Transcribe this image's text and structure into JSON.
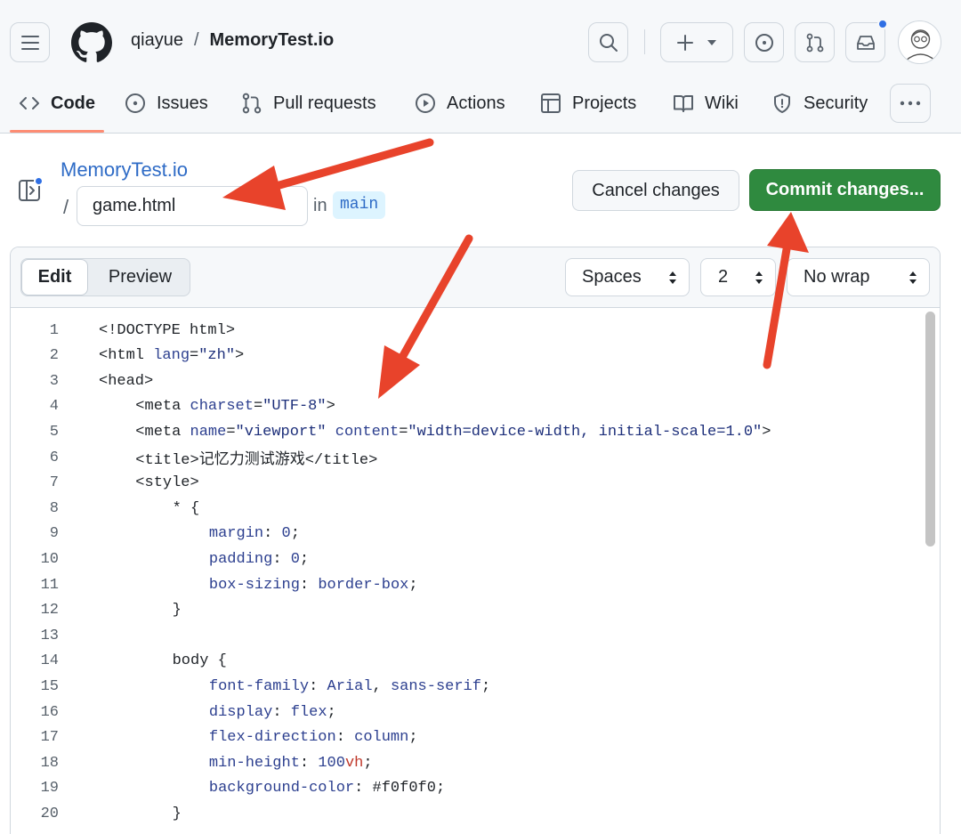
{
  "header": {
    "owner": "qiayue",
    "separator": "/",
    "repo": "MemoryTest.io"
  },
  "nav": {
    "tabs": [
      {
        "label": "Code",
        "icon": "code-icon",
        "active": true
      },
      {
        "label": "Issues",
        "icon": "issue-opened-icon"
      },
      {
        "label": "Pull requests",
        "icon": "git-pull-request-icon"
      },
      {
        "label": "Actions",
        "icon": "play-icon"
      },
      {
        "label": "Projects",
        "icon": "table-icon"
      },
      {
        "label": "Wiki",
        "icon": "book-icon"
      },
      {
        "label": "Security",
        "icon": "shield-icon"
      }
    ]
  },
  "file": {
    "repo_link": "MemoryTest.io",
    "path_sep": "/",
    "filename": "game.html",
    "in_label": "in",
    "branch": "main"
  },
  "actions": {
    "cancel": "Cancel changes",
    "commit": "Commit changes..."
  },
  "editor": {
    "mode_edit": "Edit",
    "mode_preview": "Preview",
    "indent_mode": "Spaces",
    "indent_size": "2",
    "wrap_mode": "No wrap"
  },
  "code_lines": [
    {
      "n": "1",
      "indent": 0,
      "parts": [
        [
          "",
          "<!DOCTYPE html>"
        ]
      ]
    },
    {
      "n": "2",
      "indent": 0,
      "parts": [
        [
          "",
          "<html "
        ],
        [
          "t-attr",
          "lang"
        ],
        [
          "",
          "="
        ],
        [
          "t-str",
          "\"zh\""
        ],
        [
          "",
          ">"
        ]
      ]
    },
    {
      "n": "3",
      "indent": 0,
      "parts": [
        [
          "",
          "<head>"
        ]
      ]
    },
    {
      "n": "4",
      "indent": 1,
      "parts": [
        [
          "",
          "<meta "
        ],
        [
          "t-attr",
          "charset"
        ],
        [
          "",
          "="
        ],
        [
          "t-str",
          "\"UTF-8\""
        ],
        [
          "",
          ">"
        ]
      ]
    },
    {
      "n": "5",
      "indent": 1,
      "parts": [
        [
          "",
          "<meta "
        ],
        [
          "t-attr",
          "name"
        ],
        [
          "",
          "="
        ],
        [
          "t-str",
          "\"viewport\""
        ],
        [
          "",
          " "
        ],
        [
          "t-attr",
          "content"
        ],
        [
          "",
          "="
        ],
        [
          "t-str",
          "\"width=device-width, initial-scale=1.0\""
        ],
        [
          "",
          ">"
        ]
      ]
    },
    {
      "n": "6",
      "indent": 1,
      "parts": [
        [
          "",
          "<title>记忆力测试游戏</title>"
        ]
      ]
    },
    {
      "n": "7",
      "indent": 1,
      "parts": [
        [
          "",
          "<style>"
        ]
      ]
    },
    {
      "n": "8",
      "indent": 2,
      "parts": [
        [
          "",
          "* {"
        ]
      ]
    },
    {
      "n": "9",
      "indent": 3,
      "parts": [
        [
          "t-prop",
          "margin"
        ],
        [
          "",
          ": "
        ],
        [
          "t-num",
          "0"
        ],
        [
          "",
          ";"
        ]
      ]
    },
    {
      "n": "10",
      "indent": 3,
      "parts": [
        [
          "t-prop",
          "padding"
        ],
        [
          "",
          ": "
        ],
        [
          "t-num",
          "0"
        ],
        [
          "",
          ";"
        ]
      ]
    },
    {
      "n": "11",
      "indent": 3,
      "parts": [
        [
          "t-prop",
          "box-sizing"
        ],
        [
          "",
          ": "
        ],
        [
          "t-num",
          "border-box"
        ],
        [
          "",
          ";"
        ]
      ]
    },
    {
      "n": "12",
      "indent": 2,
      "parts": [
        [
          "",
          "}"
        ]
      ]
    },
    {
      "n": "13",
      "indent": 0,
      "parts": [
        [
          "",
          ""
        ]
      ]
    },
    {
      "n": "14",
      "indent": 2,
      "parts": [
        [
          "",
          "body {"
        ]
      ]
    },
    {
      "n": "15",
      "indent": 3,
      "parts": [
        [
          "t-prop",
          "font-family"
        ],
        [
          "",
          ": "
        ],
        [
          "t-num",
          "Arial"
        ],
        [
          "",
          ", "
        ],
        [
          "t-num",
          "sans-serif"
        ],
        [
          "",
          ";"
        ]
      ]
    },
    {
      "n": "16",
      "indent": 3,
      "parts": [
        [
          "t-prop",
          "display"
        ],
        [
          "",
          ": "
        ],
        [
          "t-num",
          "flex"
        ],
        [
          "",
          ";"
        ]
      ]
    },
    {
      "n": "17",
      "indent": 3,
      "parts": [
        [
          "t-prop",
          "flex-direction"
        ],
        [
          "",
          ": "
        ],
        [
          "t-num",
          "column"
        ],
        [
          "",
          ";"
        ]
      ]
    },
    {
      "n": "18",
      "indent": 3,
      "parts": [
        [
          "t-prop",
          "min-height"
        ],
        [
          "",
          ": "
        ],
        [
          "t-num",
          "100"
        ],
        [
          "t-unit",
          "vh"
        ],
        [
          "",
          ";"
        ]
      ]
    },
    {
      "n": "19",
      "indent": 3,
      "parts": [
        [
          "t-prop",
          "background-color"
        ],
        [
          "",
          ": "
        ],
        [
          "",
          "#f0f0f0"
        ],
        [
          "",
          ";"
        ]
      ]
    },
    {
      "n": "20",
      "indent": 2,
      "parts": [
        [
          "",
          "}"
        ]
      ]
    }
  ],
  "colors": {
    "commit_green": "#2f8a3f",
    "link_blue": "#2e6bc6",
    "annotation_arrow": "#e8432b",
    "active_tab_underline": "#fd8c73"
  }
}
